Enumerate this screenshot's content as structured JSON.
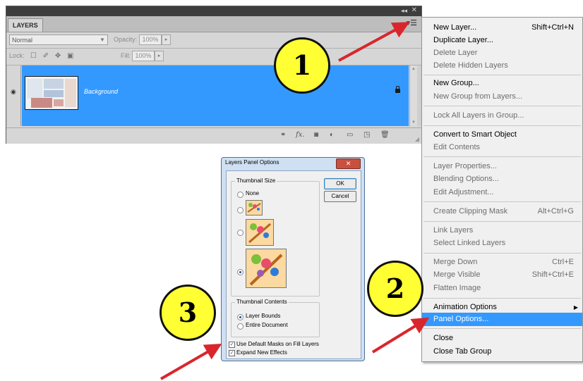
{
  "layers_panel": {
    "tab_label": "LAYERS",
    "blend_mode": "Normal",
    "opacity_label": "Opacity:",
    "opacity_value": "100%",
    "lock_label": "Lock:",
    "fill_label": "Fill:",
    "fill_value": "100%",
    "layer_name": "Background"
  },
  "flyout_menu": {
    "items": [
      {
        "label": "New Layer...",
        "shortcut": "Shift+Ctrl+N",
        "enabled": true
      },
      {
        "label": "Duplicate Layer...",
        "shortcut": "",
        "enabled": true
      },
      {
        "label": "Delete Layer",
        "shortcut": "",
        "enabled": false
      },
      {
        "label": "Delete Hidden Layers",
        "shortcut": "",
        "enabled": false
      },
      {
        "label": "New Group...",
        "shortcut": "",
        "enabled": true
      },
      {
        "label": "New Group from Layers...",
        "shortcut": "",
        "enabled": false
      },
      {
        "label": "Lock All Layers in Group...",
        "shortcut": "",
        "enabled": false
      },
      {
        "label": "Convert to Smart Object",
        "shortcut": "",
        "enabled": true
      },
      {
        "label": "Edit Contents",
        "shortcut": "",
        "enabled": false
      },
      {
        "label": "Layer Properties...",
        "shortcut": "",
        "enabled": false
      },
      {
        "label": "Blending Options...",
        "shortcut": "",
        "enabled": false
      },
      {
        "label": "Edit Adjustment...",
        "shortcut": "",
        "enabled": false
      },
      {
        "label": "Create Clipping Mask",
        "shortcut": "Alt+Ctrl+G",
        "enabled": false
      },
      {
        "label": "Link Layers",
        "shortcut": "",
        "enabled": false
      },
      {
        "label": "Select Linked Layers",
        "shortcut": "",
        "enabled": false
      },
      {
        "label": "Merge Down",
        "shortcut": "Ctrl+E",
        "enabled": false
      },
      {
        "label": "Merge Visible",
        "shortcut": "Shift+Ctrl+E",
        "enabled": false
      },
      {
        "label": "Flatten Image",
        "shortcut": "",
        "enabled": false
      },
      {
        "label": "Animation Options",
        "shortcut": "",
        "enabled": true
      },
      {
        "label": "Panel Options...",
        "shortcut": "",
        "enabled": true,
        "highlighted": true
      },
      {
        "label": "Close",
        "shortcut": "",
        "enabled": true
      },
      {
        "label": "Close Tab Group",
        "shortcut": "",
        "enabled": true
      }
    ]
  },
  "dialog": {
    "title": "Layers Panel Options",
    "ok_label": "OK",
    "cancel_label": "Cancel",
    "thumbnail_size_title": "Thumbnail Size",
    "none_label": "None",
    "thumbnail_contents_title": "Thumbnail Contents",
    "layer_bounds_label": "Layer Bounds",
    "entire_document_label": "Entire Document",
    "use_default_masks_label": "Use Default Masks on Fill Layers",
    "expand_new_effects_label": "Expand New Effects",
    "selected_thumbnail_size": "large",
    "selected_thumbnail_contents": "Layer Bounds",
    "use_default_masks_checked": true,
    "expand_new_effects_checked": true
  },
  "callouts": {
    "one": "1",
    "two": "2",
    "three": "3"
  },
  "colors": {
    "highlight": "#3399ff",
    "callout_fill": "#ffff33",
    "arrow": "#d9262c"
  }
}
